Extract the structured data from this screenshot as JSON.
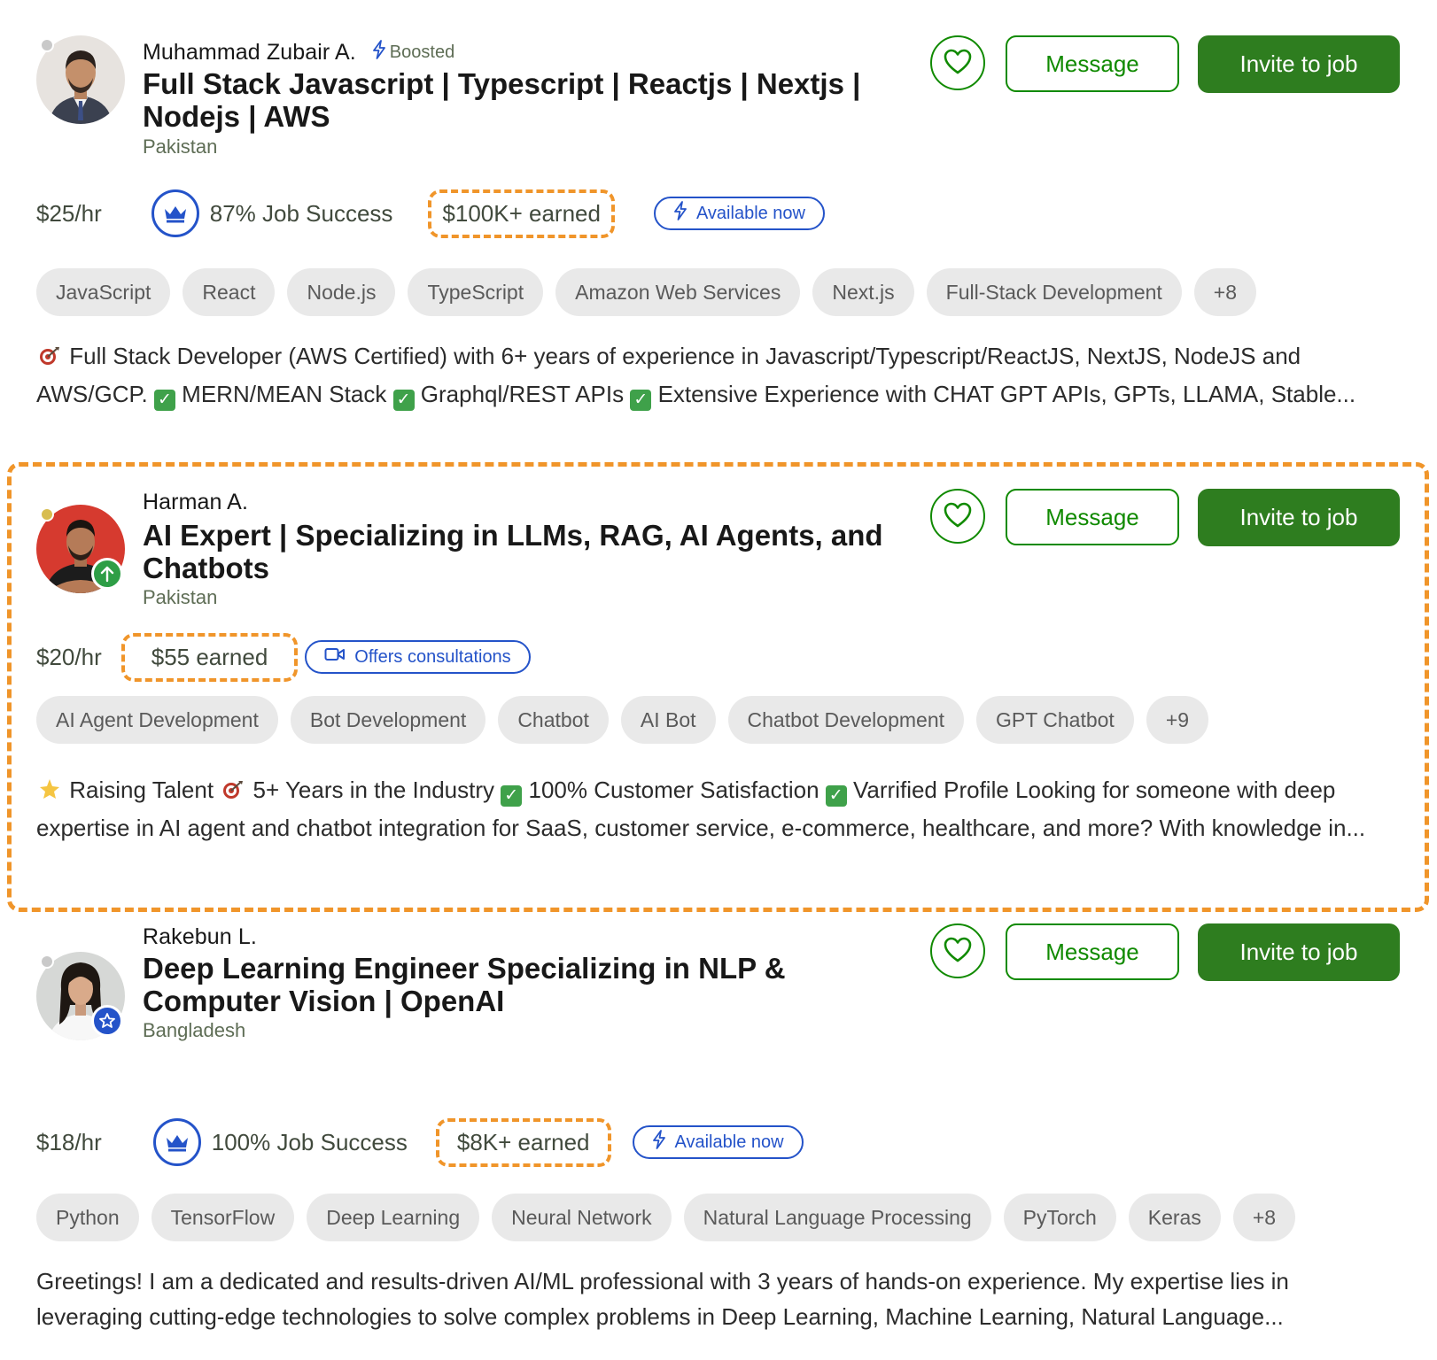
{
  "colors": {
    "brand_green": "#2e7d1f",
    "blue_accent": "#2453c9",
    "highlight_orange": "#f0952a",
    "online_dot": "#d8bd4f",
    "offline_dot": "#c9c9c9"
  },
  "actions": {
    "message_label": "Message",
    "invite_label": "Invite to job"
  },
  "freelancers": [
    {
      "name": "Muhammad Zubair A.",
      "boosted": "Boosted",
      "title": "Full Stack Javascript | Typescript | Reactjs | Nextjs | Nodejs | AWS",
      "country": "Pakistan",
      "rate": "$25/hr",
      "job_success": "87% Job Success",
      "earned": "$100K+ earned",
      "availability": "Available now",
      "skills": [
        "JavaScript",
        "React",
        "Node.js",
        "TypeScript",
        "Amazon Web Services",
        "Next.js",
        "Full-Stack Development",
        "+8"
      ],
      "desc_line1": "Full Stack Developer (AWS Certified) with 6+ years of experience in Javascript/Typescript/ReactJS, NextJS, NodeJS and",
      "desc_a": "AWS/GCP.",
      "desc_b": "MERN/MEAN Stack",
      "desc_c": "Graphql/REST APIs",
      "desc_d": "Extensive Experience with CHAT GPT APIs, GPTs, LLAMA, Stable..."
    },
    {
      "name": "Harman A.",
      "title": "AI Expert | Specializing in LLMs, RAG, AI Agents, and Chatbots",
      "country": "Pakistan",
      "rate": "$20/hr",
      "earned": "$55 earned",
      "consultations": "Offers consultations",
      "skills": [
        "AI Agent Development",
        "Bot Development",
        "Chatbot",
        "AI Bot",
        "Chatbot Development",
        "GPT Chatbot",
        "+9"
      ],
      "desc_a": "Raising Talent",
      "desc_b": "5+ Years in the Industry",
      "desc_c": "100% Customer Satisfaction",
      "desc_d": "Varrified Profile Looking for someone with deep",
      "desc_line2": "expertise in AI agent and chatbot integration for SaaS, customer service, e-commerce, healthcare, and more? With knowledge in..."
    },
    {
      "name": "Rakebun L.",
      "title": "Deep Learning Engineer Specializing in NLP & Computer Vision | OpenAI",
      "country": "Bangladesh",
      "rate": "$18/hr",
      "job_success": "100% Job Success",
      "earned": "$8K+ earned",
      "availability": "Available now",
      "skills": [
        "Python",
        "TensorFlow",
        "Deep Learning",
        "Neural Network",
        "Natural Language Processing",
        "PyTorch",
        "Keras",
        "+8"
      ],
      "desc_line1": "Greetings! I am a dedicated and results-driven AI/ML professional with 3 years of hands-on experience. My expertise lies in",
      "desc_line2": "leveraging cutting-edge technologies to solve complex problems in Deep Learning, Machine Learning, Natural Language..."
    }
  ]
}
